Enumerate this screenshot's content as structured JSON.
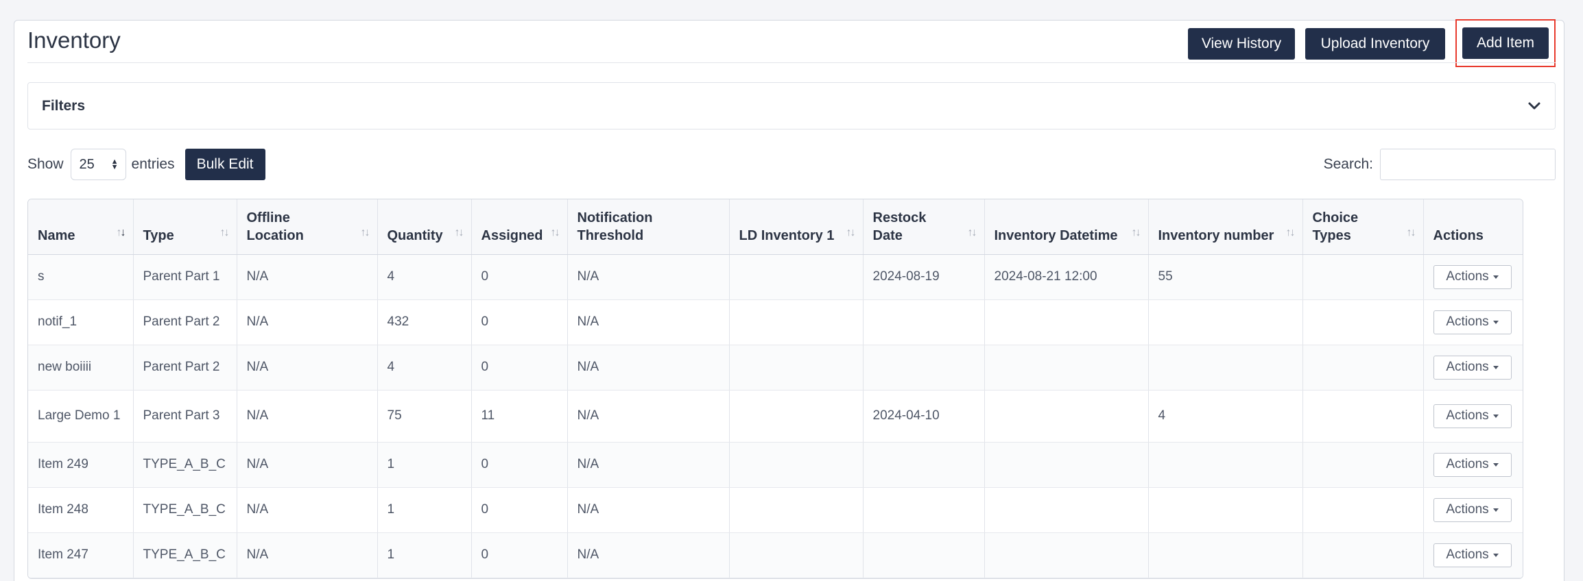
{
  "page": {
    "title": "Inventory"
  },
  "header": {
    "view_history_label": "View History",
    "upload_inventory_label": "Upload Inventory",
    "add_item_label": "Add Item"
  },
  "filters": {
    "label": "Filters"
  },
  "controls": {
    "show_label": "Show",
    "entries_value": "25",
    "entries_label": "entries",
    "bulk_edit_label": "Bulk Edit",
    "search_label": "Search:",
    "search_value": ""
  },
  "table": {
    "columns": [
      "Name",
      "Type",
      "Offline Location",
      "Quantity",
      "Assigned",
      "Notification Threshold",
      "LD Inventory 1",
      "Restock Date",
      "Inventory Datetime",
      "Inventory number",
      "Choice Types",
      "Actions"
    ],
    "action_label": "Actions",
    "rows": [
      [
        "s",
        "Parent Part 1",
        "N/A",
        "4",
        "0",
        "N/A",
        "",
        "2024-08-19",
        "2024-08-21 12:00",
        "55",
        ""
      ],
      [
        "notif_1",
        "Parent Part 2",
        "N/A",
        "432",
        "0",
        "N/A",
        "",
        "",
        "",
        "",
        ""
      ],
      [
        "new boiiii",
        "Parent Part 2",
        "N/A",
        "4",
        "0",
        "N/A",
        "",
        "",
        "",
        "",
        ""
      ],
      [
        "Large Demo 1",
        "Parent Part 3",
        "N/A",
        "75",
        "11",
        "N/A",
        "",
        "2024-04-10",
        "",
        "4",
        ""
      ],
      [
        "Item 249",
        "TYPE_A_B_C",
        "N/A",
        "1",
        "0",
        "N/A",
        "",
        "",
        "",
        "",
        ""
      ],
      [
        "Item 248",
        "TYPE_A_B_C",
        "N/A",
        "1",
        "0",
        "N/A",
        "",
        "",
        "",
        "",
        ""
      ],
      [
        "Item 247",
        "TYPE_A_B_C",
        "N/A",
        "1",
        "0",
        "N/A",
        "",
        "",
        "",
        "",
        ""
      ]
    ]
  },
  "colors": {
    "primary_button": "#222f4a",
    "highlight_outline": "#e8392c"
  }
}
